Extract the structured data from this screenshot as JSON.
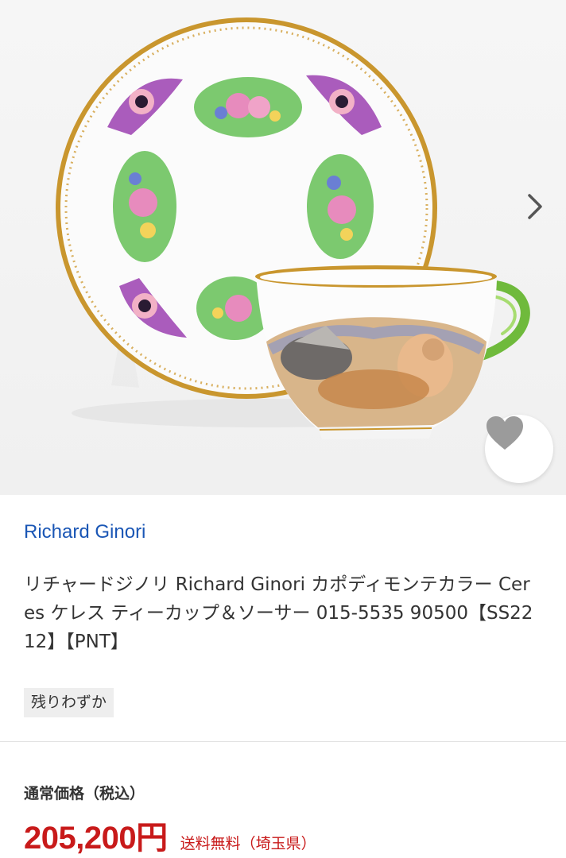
{
  "product_image": {
    "alt": "Richard Ginori Capodimonte Ceres tea cup and saucer"
  },
  "icons": {
    "next": "chevron-right-icon",
    "favorite": "heart-icon"
  },
  "brand": {
    "name": "Richard Ginori"
  },
  "product": {
    "title": "リチャードジノリ Richard Ginori カポディモンテカラー Ceres ケレス ティーカップ＆ソーサー 015-5535 90500【SS2212】【PNT】",
    "stock_badge": "残りわずか"
  },
  "price": {
    "label": "通常価格（税込）",
    "value": "205,200円",
    "shipping": "送料無料（埼玉県）"
  },
  "colors": {
    "brand_link": "#1a56b5",
    "price": "#c81a1a",
    "badge_bg": "#eeeeee",
    "gold_rim": "#c9962e"
  }
}
